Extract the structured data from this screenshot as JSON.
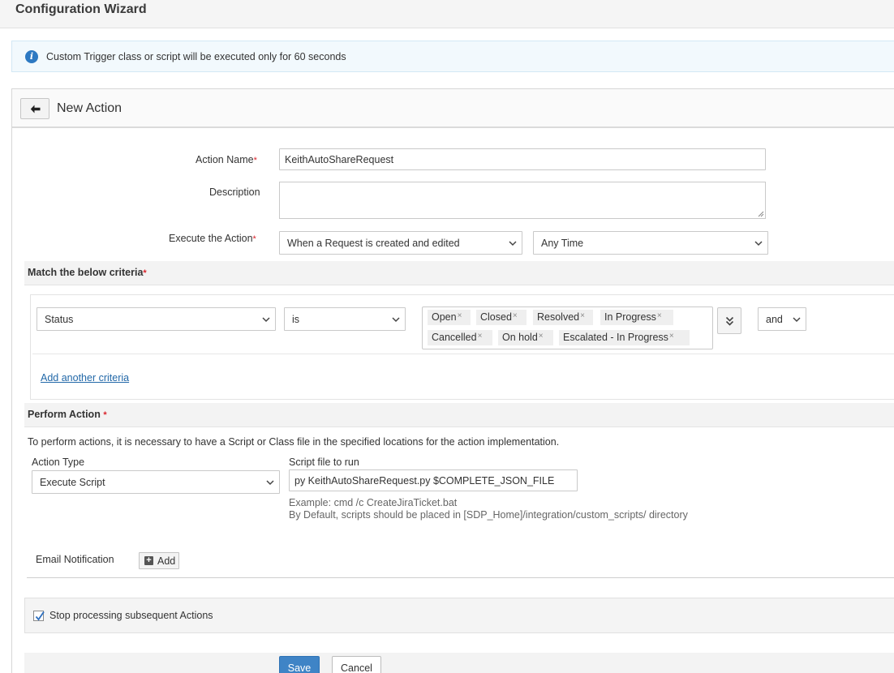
{
  "app": {
    "title": "Configuration Wizard"
  },
  "info": {
    "icon": "info-icon",
    "message": "Custom Trigger class or script will be executed only for 60 seconds"
  },
  "panel": {
    "back_icon": "arrow-left-icon",
    "title": "New Action"
  },
  "form": {
    "action_name_label": "Action Name",
    "action_name_value": "KeithAutoShareRequest",
    "description_label": "Description",
    "description_value": "",
    "execute_label": "Execute the Action",
    "execute_when": "When a Request is created and edited",
    "execute_time": "Any Time",
    "required_mark": "*"
  },
  "criteria": {
    "heading": "Match the below criteria",
    "field": "Status",
    "operator": "is",
    "values": [
      "Open",
      "Closed",
      "Resolved",
      "In Progress",
      "Cancelled",
      "On hold",
      "Escalated - In Progress"
    ],
    "remove_mark": "×",
    "conjunction": "and",
    "add_link": "Add another criteria"
  },
  "perform": {
    "heading": "Perform Action",
    "description": "To perform actions, it is necessary to have a Script or Class file in the specified locations for the action implementation.",
    "action_type_label": "Action Type",
    "action_type_value": "Execute Script",
    "script_label": "Script file to run",
    "script_value": "py KeithAutoShareRequest.py $COMPLETE_JSON_FILE",
    "example": "Example: cmd /c CreateJiraTicket.bat",
    "default_note": "By Default, scripts should be placed in [SDP_Home]/integration/custom_scripts/ directory"
  },
  "email": {
    "label": "Email Notification",
    "add_label": "Add"
  },
  "stop": {
    "label": "Stop processing subsequent Actions",
    "checked": true
  },
  "buttons": {
    "save": "Save",
    "cancel": "Cancel"
  },
  "colors": {
    "primary": "#3f84c6",
    "link": "#2268a8",
    "required": "#d9242b",
    "info": "#2d79c2"
  }
}
